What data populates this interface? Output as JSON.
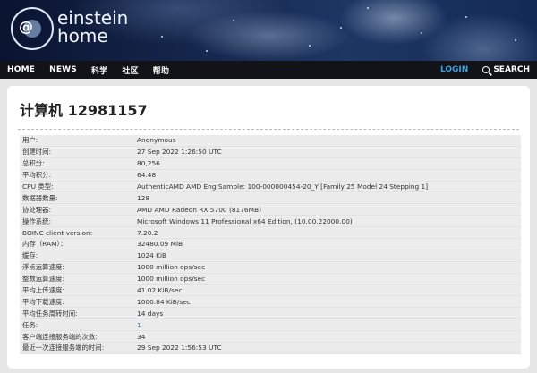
{
  "brand": {
    "line1": "einstein",
    "line2": "home",
    "at": "@"
  },
  "nav": {
    "items": [
      "HOME",
      "NEWS",
      "科学",
      "社区",
      "帮助"
    ],
    "login": "LOGIN",
    "search": "SEARCH"
  },
  "page": {
    "title": "计算机 12981157"
  },
  "rows": [
    {
      "k": "用户:",
      "v": "Anonymous"
    },
    {
      "k": "创建时间:",
      "v": "27 Sep 2022 1:26:50 UTC"
    },
    {
      "k": "总积分:",
      "v": "80,256"
    },
    {
      "k": "平均积分:",
      "v": "64.48"
    },
    {
      "k": "CPU 类型:",
      "v": "AuthenticAMD AMD Eng Sample: 100-000000454-20_Y [Family 25 Model 24 Stepping 1]"
    },
    {
      "k": "数据器数量:",
      "v": "128"
    },
    {
      "k": "协处理器:",
      "v": "AMD AMD Radeon RX 5700 (8176MB)"
    },
    {
      "k": "操作系统:",
      "v": "Microsoft Windows 11 Professional x64 Edition, (10.00.22000.00)"
    },
    {
      "k": "BOINC client version:",
      "v": "7.20.2"
    },
    {
      "k": "内存（RAM）：",
      "v": "32480.09 MiB"
    },
    {
      "k": "缓存:",
      "v": "1024 KiB"
    },
    {
      "k": "浮点运算速度:",
      "v": "1000 million ops/sec"
    },
    {
      "k": "整数运算速度:",
      "v": "1000 million ops/sec"
    },
    {
      "k": "平均上传速度:",
      "v": "41.02 KiB/sec"
    },
    {
      "k": "平均下载速度:",
      "v": "1000.84 KiB/sec"
    },
    {
      "k": "平均任务周转时间:",
      "v": "14 days"
    },
    {
      "k": "任务:",
      "v": "1"
    },
    {
      "k": "客户端连接服务端的次数:",
      "v": "34"
    },
    {
      "k": "最近一次连接服务端的时间:",
      "v": "29 Sep 2022 1:56:53 UTC"
    }
  ]
}
